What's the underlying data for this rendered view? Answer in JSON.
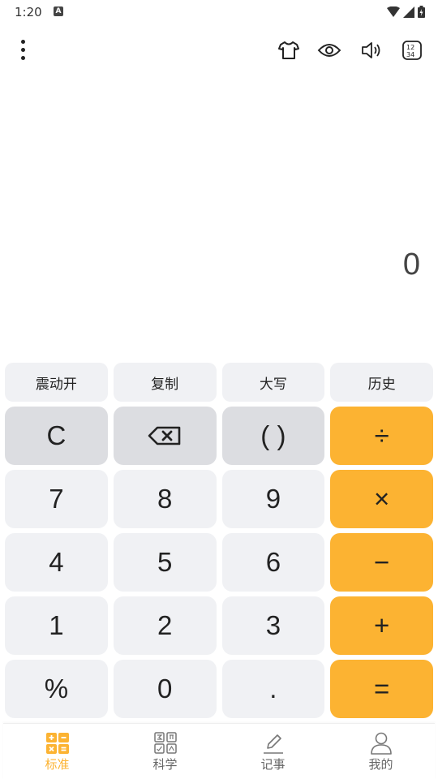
{
  "status": {
    "time": "1:20",
    "badge": "A"
  },
  "display": {
    "value": "0"
  },
  "func_buttons": [
    {
      "label": "震动开"
    },
    {
      "label": "复制"
    },
    {
      "label": "大写"
    },
    {
      "label": "历史"
    }
  ],
  "keys": {
    "clear": "C",
    "parens": "( )",
    "divide": "÷",
    "seven": "7",
    "eight": "8",
    "nine": "9",
    "multiply": "×",
    "four": "4",
    "five": "5",
    "six": "6",
    "minus": "−",
    "one": "1",
    "two": "2",
    "three": "3",
    "plus": "+",
    "percent": "%",
    "zero": "0",
    "dot": ".",
    "equals": "="
  },
  "tabs": [
    {
      "label": "标准",
      "icon": "standard-calc-icon",
      "active": true
    },
    {
      "label": "科学",
      "icon": "scientific-calc-icon",
      "active": false
    },
    {
      "label": "记事",
      "icon": "notes-edit-icon",
      "active": false
    },
    {
      "label": "我的",
      "icon": "profile-icon",
      "active": false
    }
  ],
  "colors": {
    "accent": "#fcb332",
    "key_bg": "#f0f1f4",
    "key_gray": "#dcdde1"
  }
}
